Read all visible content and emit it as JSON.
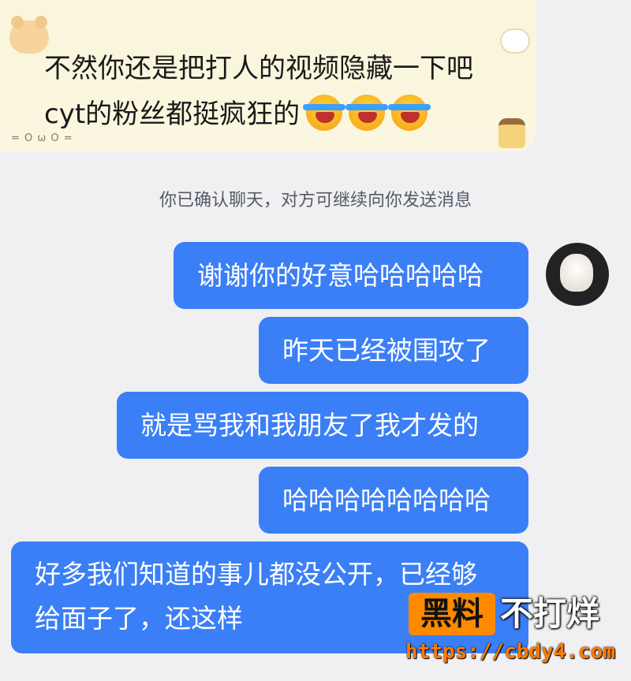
{
  "incoming_message": {
    "line1": "不然你还是把打人的视频隐藏一下吧",
    "line2": "cyt的粉丝都挺疯狂的",
    "emojis": [
      "tears-of-joy-icon",
      "tears-of-joy-icon",
      "tears-of-joy-icon"
    ]
  },
  "system_note": "你已确认聊天，对方可继续向你发送消息",
  "outgoing_messages": [
    {
      "text": "谢谢你的好意哈哈哈哈哈"
    },
    {
      "text": "昨天已经被围攻了"
    },
    {
      "text": "就是骂我和我朋友了我才发的"
    },
    {
      "text": "哈哈哈哈哈哈哈哈"
    },
    {
      "line1": "好多我们知道的事儿都没公开，已经够",
      "line2": "给面子了，还这样"
    }
  ],
  "watermark": {
    "box_text": "黑料",
    "right_text": "不打烊",
    "url": "https://cbdy4.com"
  },
  "colors": {
    "bubble_outgoing": "#3b7ff6",
    "bubble_incoming": "#faf6dc",
    "background": "#f0f0f3",
    "watermark_accent": "#ff8a00"
  }
}
